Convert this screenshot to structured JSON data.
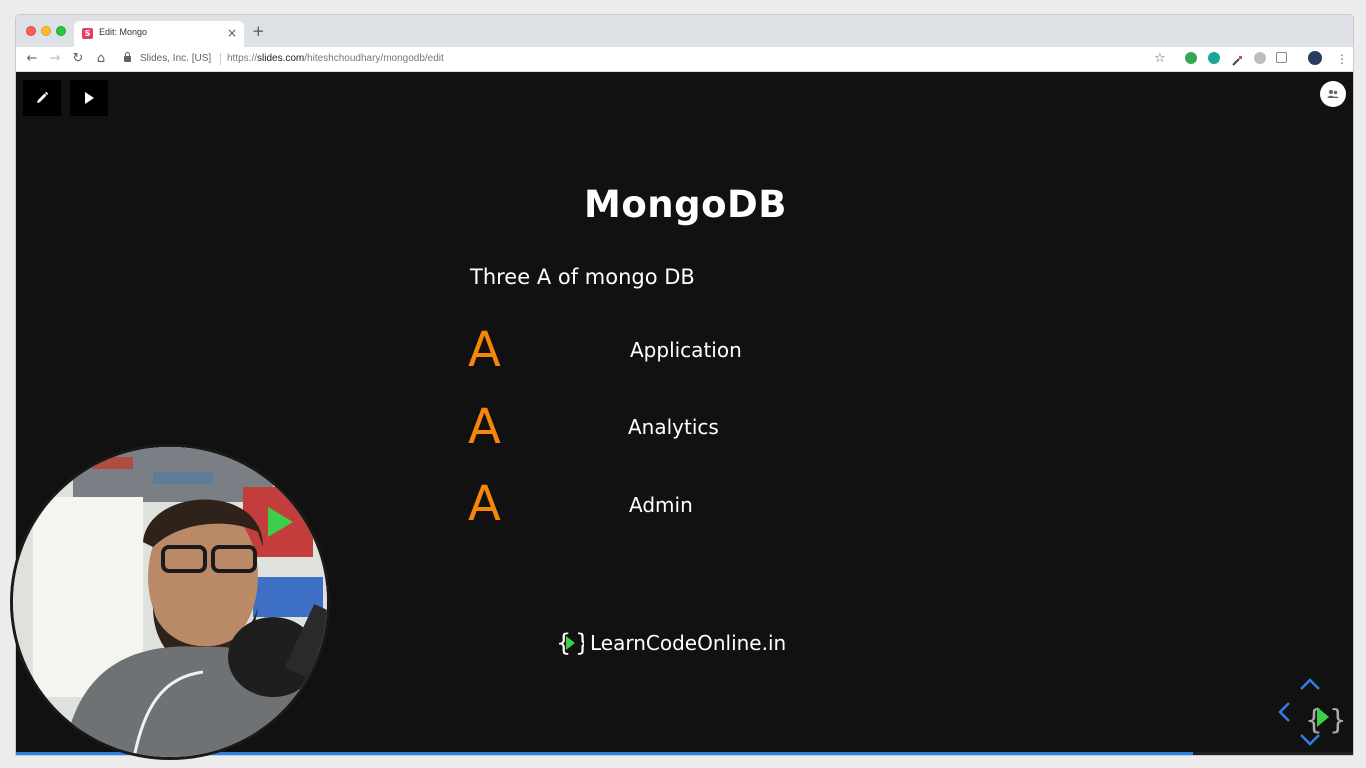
{
  "browser": {
    "tab_title": "Edit: Mongo",
    "tab_favicon_letter": "S",
    "close_glyph": "×",
    "new_tab_glyph": "+",
    "site_identity": "Slides, Inc. [US]",
    "url_scheme": "https://",
    "url_host": "slides.com",
    "url_path": "/hiteshchoudhary/mongodb/edit",
    "nav": {
      "back_glyph": "←",
      "forward_glyph": "→",
      "reload_glyph": "↻",
      "home_glyph": "⌂",
      "bookmark_glyph": "☆",
      "menu_glyph": "⋮"
    }
  },
  "editor": {
    "edit_icon": "pencil-icon",
    "present_icon": "play-icon",
    "collab_icon": "people-icon"
  },
  "slide": {
    "title": "MongoDB",
    "subtitle": "Three A of mongo DB",
    "items": [
      {
        "letter": "A",
        "label": "Application"
      },
      {
        "letter": "A",
        "label": "Analytics"
      },
      {
        "letter": "A",
        "label": "Admin"
      }
    ],
    "brand": {
      "text": "LearnCodeOnline.in"
    },
    "progress_fraction": 0.88
  },
  "colors": {
    "accent_orange": "#f5860a",
    "slide_background": "#111111",
    "progress_blue": "#2f7fe6",
    "brand_green": "#3ecf4a"
  }
}
